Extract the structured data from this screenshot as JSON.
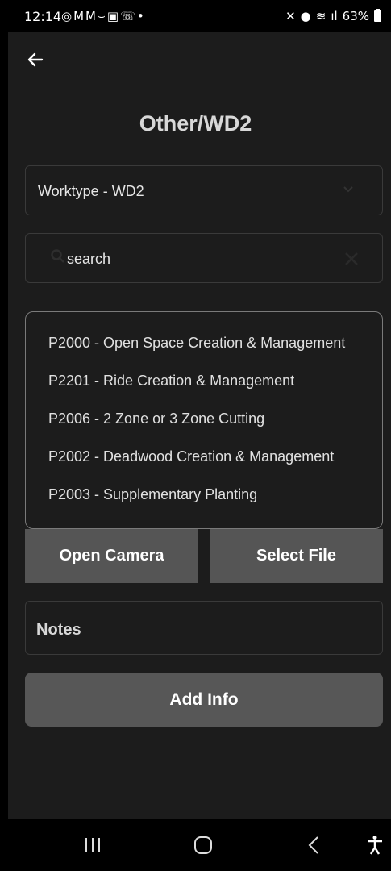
{
  "status_bar": {
    "time": "12:14",
    "battery": "63%",
    "notification_icons": [
      "whatsapp-icon",
      "gmail-icon",
      "gmail-icon",
      "missed-call-icon",
      "gallery-icon",
      "wifi-call-icon",
      "dot-icon"
    ],
    "status_icons": [
      "mute-icon",
      "location-icon",
      "wifi-icon",
      "wifi-call-icon",
      "signal-icon",
      "battery-icon"
    ]
  },
  "header": {
    "title": "Other/WD2"
  },
  "worktype": {
    "value": "Worktype - WD2"
  },
  "search": {
    "value": "search"
  },
  "dropdown": {
    "options": [
      "P2000 - Open Space Creation & Management",
      "P2201 - Ride Creation & Management",
      "P2006 - 2 Zone or 3 Zone Cutting",
      "P2002 - Deadwood Creation & Management",
      "P2003 - Supplementary Planting"
    ]
  },
  "actions": {
    "open_camera": "Open Camera",
    "select_file": "Select File"
  },
  "notes": {
    "label": "Notes"
  },
  "add_info": {
    "label": "Add Info"
  },
  "colors": {
    "background": "#1c1c1c",
    "button": "#555555",
    "border": "#3a3a3a"
  }
}
